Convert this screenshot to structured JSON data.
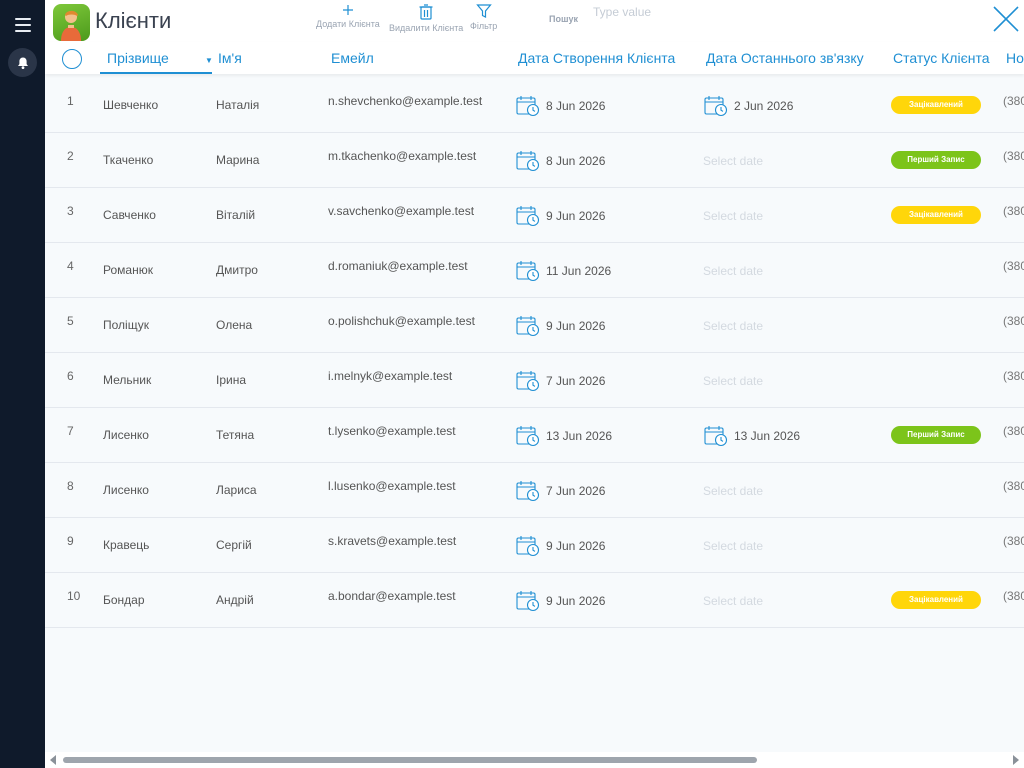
{
  "app": {
    "title": "Клієнти",
    "icon": "person-avatar-icon"
  },
  "toolbar": {
    "add_label": "Додати Клієнта",
    "delete_label": "Видалити Клієнта",
    "filter_label": "Фільтр",
    "search_label": "Пошук",
    "search_placeholder": "Type value",
    "search_value": ""
  },
  "columns": {
    "last_name": "Прізвище",
    "first_name": "Ім'я",
    "email": "Емейл",
    "created": "Дата Створення Клієнта",
    "last_contact": "Дата Останнього зв'язку",
    "status": "Статус Клієнта",
    "phone": "Но"
  },
  "sort": {
    "column": "last_name",
    "direction": "descending"
  },
  "colors": {
    "accent": "#1f8fd3",
    "status_interested": "#ffd60a",
    "status_first_appointment": "#7cc41a",
    "sidebar": "#0f1a2b"
  },
  "rows": [
    {
      "num": "1",
      "last": "Шевченко",
      "first": "Наталія",
      "email": "n.shevchenko@example.test",
      "created": "8 Jun 2026",
      "contact": "2 Jun 2026",
      "status": "Зацікавлений",
      "phone": "(380"
    },
    {
      "num": "2",
      "last": "Ткаченко",
      "first": "Марина",
      "email": "m.tkachenko@example.test",
      "created": "8 Jun 2026",
      "contact": "Select date",
      "status": "Перший Запис",
      "phone": "(380"
    },
    {
      "num": "3",
      "last": "Савченко",
      "first": "Віталій",
      "email": "v.savchenko@example.test",
      "created": "9 Jun 2026",
      "contact": "Select date",
      "status": "Зацікавлений",
      "phone": "(380"
    },
    {
      "num": "4",
      "last": "Романюк",
      "first": "Дмитро",
      "email": "d.romaniuk@example.test",
      "created": "11 Jun 2026",
      "contact": "Select date",
      "status": "",
      "phone": "(380"
    },
    {
      "num": "5",
      "last": "Поліщук",
      "first": "Олена",
      "email": "o.polishchuk@example.test",
      "created": "9 Jun 2026",
      "contact": "Select date",
      "status": "",
      "phone": "(380"
    },
    {
      "num": "6",
      "last": "Мельник",
      "first": "Ірина",
      "email": "i.melnyk@example.test",
      "created": "7 Jun 2026",
      "contact": "Select date",
      "status": "",
      "phone": "(380"
    },
    {
      "num": "7",
      "last": "Лисенко",
      "first": "Тетяна",
      "email": "t.lysenko@example.test",
      "created": "13 Jun 2026",
      "contact": "13 Jun 2026",
      "status": "Перший Запис",
      "phone": "(380"
    },
    {
      "num": "8",
      "last": "Лисенко",
      "first": "Лариса",
      "email": "l.lusenko@example.test",
      "created": "7 Jun 2026",
      "contact": "Select date",
      "status": "",
      "phone": "(380"
    },
    {
      "num": "9",
      "last": "Кравець",
      "first": "Сергій",
      "email": "s.kravets@example.test",
      "created": "9 Jun 2026",
      "contact": "Select date",
      "status": "",
      "phone": "(380"
    },
    {
      "num": "10",
      "last": "Бондар",
      "first": "Андрій",
      "email": "a.bondar@example.test",
      "created": "9 Jun 2026",
      "contact": "Select date",
      "status": "Зацікавлений",
      "phone": "(380"
    }
  ],
  "status_colors": {
    "Зацікавлений": "#ffd60a",
    "Перший Запис": "#7cc41a"
  }
}
